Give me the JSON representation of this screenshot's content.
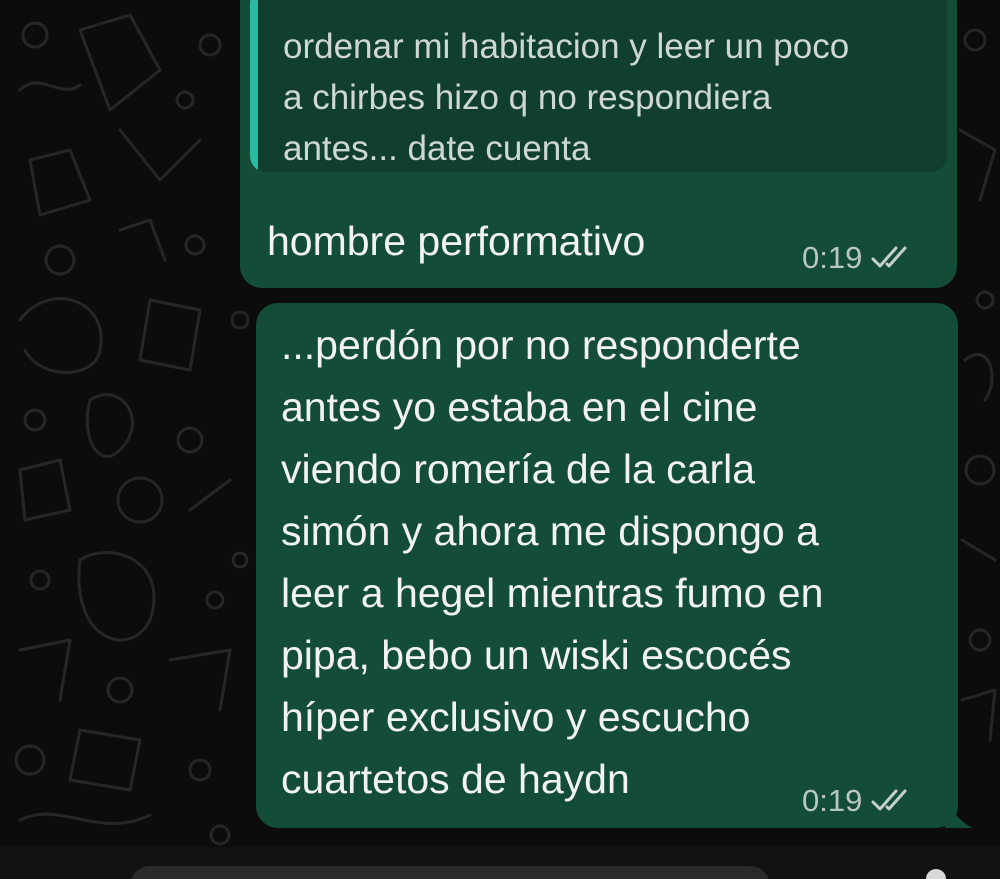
{
  "conversation": {
    "messages": [
      {
        "quoted_text": "ordenar mi habitacion y leer un poco\na chirbes hizo q no respondiera\nantes... date cuenta",
        "text": "hombre performativo",
        "time": "0:19",
        "status_icon": "double-check-icon"
      },
      {
        "text": "...perdón por no responderte\nantes yo estaba en el cine\nviendo romería de la carla\nsimón y ahora me dispongo a\nleer a hegel mientras fumo en\npipa, bebo un wiski escocés\nhíper exclusivo y escucho\ncuartetos de haydn",
        "time": "0:19",
        "status_icon": "double-check-icon"
      }
    ]
  },
  "colors": {
    "background": "#0c0c0c",
    "outgoing_bubble": "#134d37",
    "quote_background": "#103f2e",
    "quote_accent": "#29bba0",
    "meta_text": "#b8c7c0"
  }
}
